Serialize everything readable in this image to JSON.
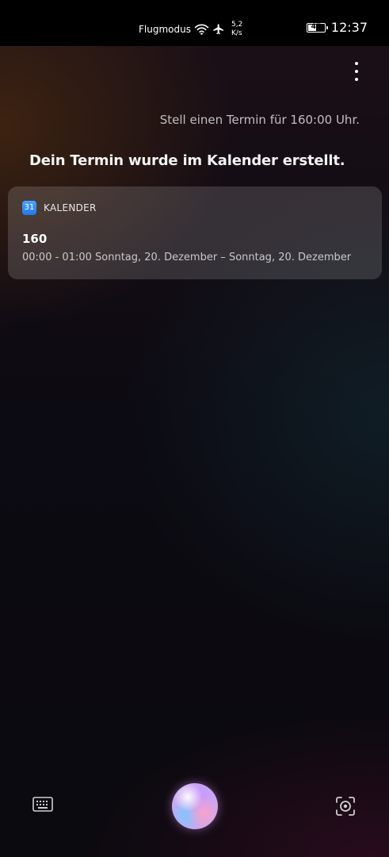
{
  "status_bar": {
    "mode_label": "Flugmodus",
    "net_speed_value": "5,2",
    "net_speed_unit": "K/s",
    "battery_level": "47",
    "time": "12:37"
  },
  "conversation": {
    "user_query": "Stell einen Termin für 160:00 Uhr.",
    "assistant_reply": "Dein Termin wurde im Kalender erstellt."
  },
  "calendar_card": {
    "app_icon_number": "31",
    "app_name": "KALENDER",
    "event_title": "160",
    "event_time": "00:00 - 01:00 Sonntag, 20. Dezember – Sonntag, 20. Dezember"
  },
  "icons": {
    "wifi": "wifi-icon",
    "airplane": "airplane-icon",
    "battery": "battery-icon",
    "menu": "more-vert-icon",
    "keyboard": "keyboard-icon",
    "voice": "voice-assistant-orb",
    "scan": "scan-icon"
  },
  "colors": {
    "calendar_accent": "#2f86f0"
  }
}
